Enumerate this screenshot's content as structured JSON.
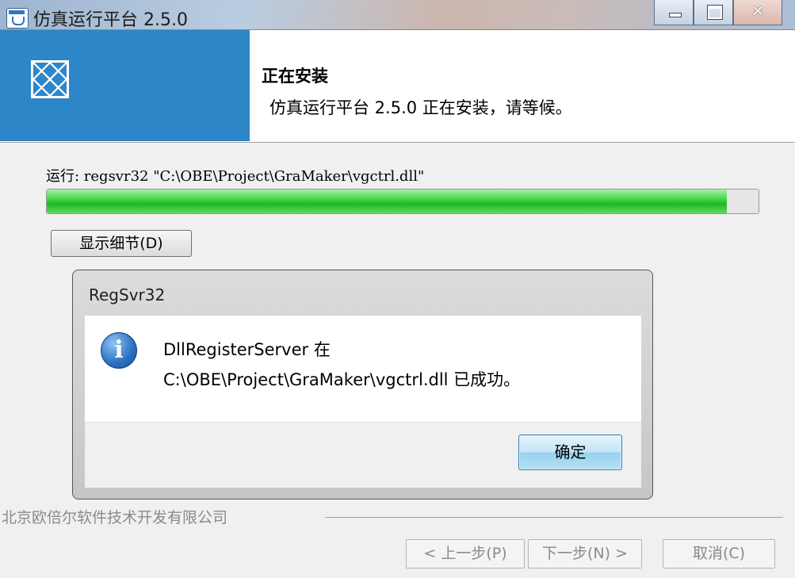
{
  "window": {
    "title": "仿真运行平台 2.5.0",
    "controls": {
      "minimize": "—",
      "maximize": "□",
      "close": "✕"
    }
  },
  "header": {
    "title": "正在安装",
    "subtitle": "仿真运行平台 2.5.0 正在安装，请等候。",
    "brand_color": "#2d86c8"
  },
  "install": {
    "run_text": "运行: regsvr32 \"C:\\OBE\\Project\\GraMaker\\vgctrl.dll\"",
    "progress": 0.955,
    "details_button": "显示细节(D)"
  },
  "dialog": {
    "title": "RegSvr32",
    "icon": "info-icon",
    "icon_glyph": "i",
    "line1": "DllRegisterServer 在",
    "line2": "C:\\OBE\\Project\\GraMaker\\vgctrl.dll 已成功。",
    "ok_button": "确定"
  },
  "footer": {
    "company": "北京欧倍尔软件技术开发有限公司",
    "back_button": "< 上一步(P)",
    "next_button": "下一步(N) >",
    "cancel_button": "取消(C)"
  }
}
